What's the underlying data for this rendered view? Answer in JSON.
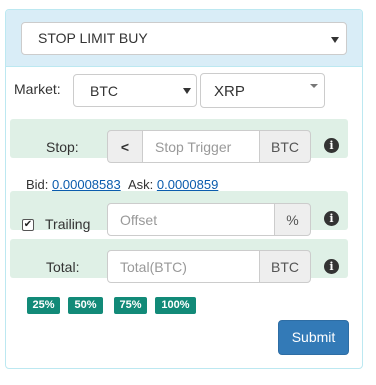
{
  "order_type": {
    "selected": "STOP LIMIT BUY"
  },
  "market": {
    "label": "Market:",
    "base_selected": "BTC",
    "quote_selected": "XRP"
  },
  "stop": {
    "label": "Stop:",
    "direction_label": "<",
    "placeholder": "Stop Trigger",
    "unit": "BTC"
  },
  "quotes": {
    "bid_label": "Bid:",
    "bid_value": "0.00008583",
    "ask_label": "Ask:",
    "ask_value": "0.0000859"
  },
  "trailing": {
    "label": "Trailing",
    "checked": true,
    "placeholder": "Offset",
    "unit": "%"
  },
  "total": {
    "label": "Total:",
    "placeholder": "Total(BTC)",
    "unit": "BTC"
  },
  "percent_buttons": [
    "25%",
    "50%",
    "75%",
    "100%"
  ],
  "submit_label": "Submit"
}
